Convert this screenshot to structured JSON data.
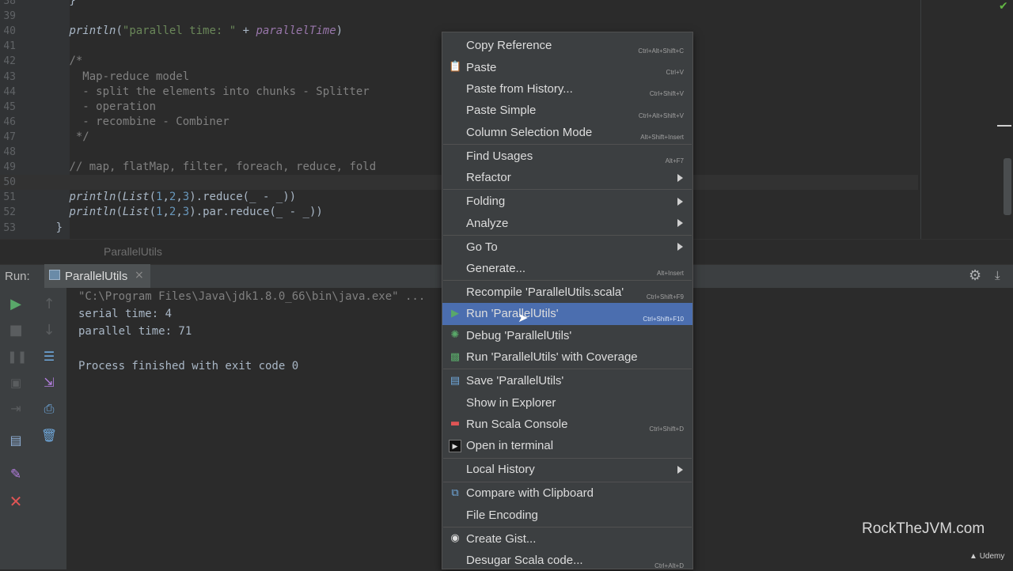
{
  "editor": {
    "lines": [
      {
        "num": "38",
        "html": "        }"
      },
      {
        "num": "39",
        "html": ""
      },
      {
        "num": "40",
        "html": "        <span class='fn'>println</span>(<span class='str'>\"parallel time: \"</span> + <span class='pv'>parallelTime</span>)"
      },
      {
        "num": "41",
        "html": ""
      },
      {
        "num": "42",
        "html": "        <span class='cm'>/*</span>"
      },
      {
        "num": "43",
        "html": "<span class='cm'>          Map-reduce model</span>"
      },
      {
        "num": "44",
        "html": "<span class='cm'>          - split the elements into chunks - Splitter</span>"
      },
      {
        "num": "45",
        "html": "<span class='cm'>          - operation</span>"
      },
      {
        "num": "46",
        "html": "<span class='cm'>          - recombine - Combiner</span>"
      },
      {
        "num": "47",
        "html": "<span class='cm'>         */</span>"
      },
      {
        "num": "48",
        "html": ""
      },
      {
        "num": "49",
        "html": "        <span class='cm'>// map, flatMap, filter, foreach, reduce, fold</span>"
      },
      {
        "num": "50",
        "html": "",
        "current": true
      },
      {
        "num": "51",
        "html": "        <span class='fn'>println</span>(<span class='it'>List</span>(<span class='num'>1</span>,<span class='num'>2</span>,<span class='num'>3</span>).reduce(_ - _))"
      },
      {
        "num": "52",
        "html": "        <span class='fn'>println</span>(<span class='it'>List</span>(<span class='num'>1</span>,<span class='num'>2</span>,<span class='num'>3</span>).par.reduce(_ - _))"
      },
      {
        "num": "53",
        "html": "      }"
      }
    ],
    "breadcrumb": "ParallelUtils"
  },
  "run_panel": {
    "label": "Run:",
    "tab_title": "ParallelUtils",
    "tab_close": "×",
    "console_lines": [
      {
        "text": "\"C:\\Program Files\\Java\\jdk1.8.0_66\\bin\\java.exe\" ...",
        "kind": "cmd"
      },
      {
        "text": "serial time: 4",
        "kind": "out"
      },
      {
        "text": "parallel time: 71",
        "kind": "out"
      },
      {
        "text": "",
        "kind": "out"
      },
      {
        "text": "Process finished with exit code 0",
        "kind": "out"
      }
    ]
  },
  "context_menu": {
    "items": [
      {
        "label": "Copy Reference",
        "shortcut": "Ctrl+Alt+Shift+C",
        "name": "menu-item-copy-reference"
      },
      {
        "label": "Paste",
        "shortcut": "Ctrl+V",
        "icon": "clipboard-icon",
        "name": "menu-item-paste"
      },
      {
        "label": "Paste from History...",
        "shortcut": "Ctrl+Shift+V",
        "name": "menu-item-paste-from-history"
      },
      {
        "label": "Paste Simple",
        "shortcut": "Ctrl+Alt+Shift+V",
        "name": "menu-item-paste-simple"
      },
      {
        "label": "Column Selection Mode",
        "shortcut": "Alt+Shift+Insert",
        "name": "menu-item-column-selection-mode",
        "sep_after": true
      },
      {
        "label": "Find Usages",
        "shortcut": "Alt+F7",
        "name": "menu-item-find-usages"
      },
      {
        "label": "Refactor",
        "submenu": true,
        "name": "menu-item-refactor",
        "sep_after": true
      },
      {
        "label": "Folding",
        "submenu": true,
        "name": "menu-item-folding"
      },
      {
        "label": "Analyze",
        "submenu": true,
        "name": "menu-item-analyze",
        "sep_after": true
      },
      {
        "label": "Go To",
        "submenu": true,
        "name": "menu-item-go-to"
      },
      {
        "label": "Generate...",
        "shortcut": "Alt+Insert",
        "name": "menu-item-generate",
        "sep_after": true
      },
      {
        "label": "Recompile 'ParallelUtils.scala'",
        "shortcut": "Ctrl+Shift+F9",
        "name": "menu-item-recompile"
      },
      {
        "label": "Run 'ParallelUtils'",
        "shortcut": "Ctrl+Shift+F10",
        "icon": "run-icon",
        "selected": true,
        "name": "menu-item-run"
      },
      {
        "label": "Debug 'ParallelUtils'",
        "icon": "debug-icon",
        "name": "menu-item-debug"
      },
      {
        "label": "Run 'ParallelUtils' with Coverage",
        "icon": "coverage-icon",
        "name": "menu-item-run-with-coverage",
        "sep_after": true
      },
      {
        "label": "Save 'ParallelUtils'",
        "icon": "save-config-icon",
        "name": "menu-item-save-config"
      },
      {
        "label": "Show in Explorer",
        "name": "menu-item-show-in-explorer"
      },
      {
        "label": "Run Scala Console",
        "shortcut": "Ctrl+Shift+D",
        "icon": "scala-console-icon",
        "name": "menu-item-run-scala-console"
      },
      {
        "label": "Open in terminal",
        "icon": "terminal-icon",
        "name": "menu-item-open-in-terminal",
        "sep_after": true
      },
      {
        "label": "Local History",
        "submenu": true,
        "name": "menu-item-local-history",
        "sep_after": true
      },
      {
        "label": "Compare with Clipboard",
        "icon": "compare-icon",
        "name": "menu-item-compare-with-clipboard"
      },
      {
        "label": "File Encoding",
        "name": "menu-item-file-encoding",
        "sep_after": true
      },
      {
        "label": "Create Gist...",
        "icon": "github-icon",
        "name": "menu-item-create-gist"
      },
      {
        "label": "Desugar Scala code...",
        "shortcut": "Ctrl+Alt+D",
        "name": "menu-item-desugar-scala-code"
      }
    ]
  },
  "watermark": "RockTheJVM.com",
  "badge": "Udemy",
  "colors": {
    "editor_bg": "#2b2b2b",
    "panel_bg": "#3c3f41",
    "menu_selected": "#4b6eaf",
    "run_green": "#59a869",
    "stop_red": "#e05555"
  }
}
